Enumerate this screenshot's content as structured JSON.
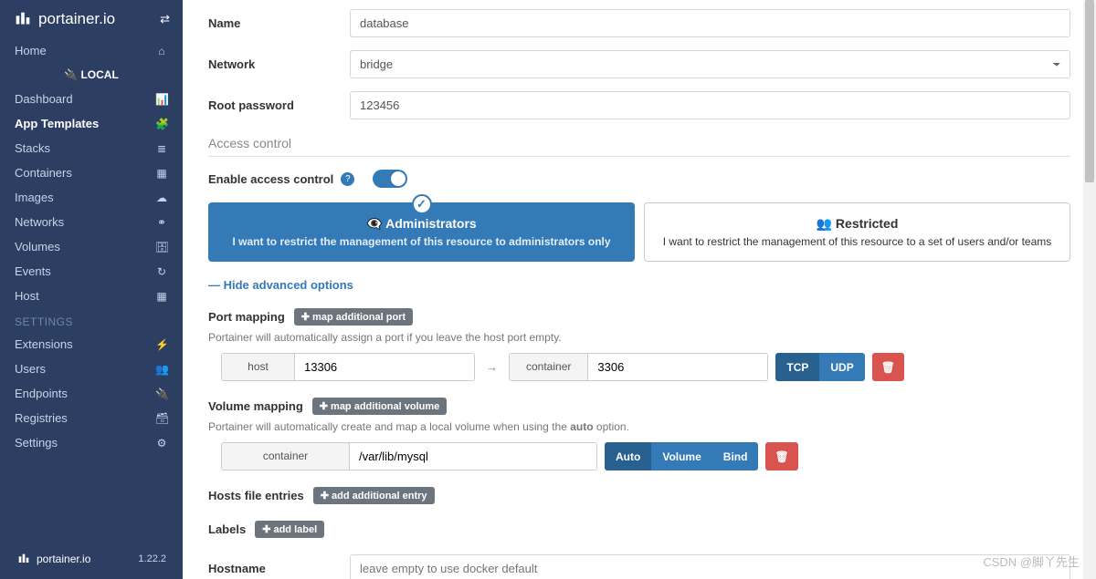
{
  "brand": "portainer.io",
  "version": "1.22.2",
  "sidebar": {
    "home": "Home",
    "local": "LOCAL",
    "items": [
      {
        "label": "Dashboard",
        "icon": "📊"
      },
      {
        "label": "App Templates",
        "icon": "🧩"
      },
      {
        "label": "Stacks",
        "icon": "≣"
      },
      {
        "label": "Containers",
        "icon": "▦"
      },
      {
        "label": "Images",
        "icon": "☁"
      },
      {
        "label": "Networks",
        "icon": "⚭"
      },
      {
        "label": "Volumes",
        "icon": "🗄"
      },
      {
        "label": "Events",
        "icon": "↻"
      },
      {
        "label": "Host",
        "icon": "▦"
      }
    ],
    "settings_hdr": "SETTINGS",
    "settings": [
      {
        "label": "Extensions",
        "icon": "⚡"
      },
      {
        "label": "Users",
        "icon": "👥"
      },
      {
        "label": "Endpoints",
        "icon": "🔌"
      },
      {
        "label": "Registries",
        "icon": "🗃"
      },
      {
        "label": "Settings",
        "icon": "⚙"
      }
    ]
  },
  "form": {
    "name_lbl": "Name",
    "name_val": "database",
    "network_lbl": "Network",
    "network_val": "bridge",
    "rootpw_lbl": "Root password",
    "rootpw_val": "123456",
    "access_hdr": "Access control",
    "enable_lbl": "Enable access control",
    "card_admin_title": "Administrators",
    "card_admin_desc": "I want to restrict the management of this resource to administrators only",
    "card_rest_title": "Restricted",
    "card_rest_desc": "I want to restrict the management of this resource to a set of users and/or teams",
    "hide_adv": "—  Hide advanced options",
    "port_hdr": "Port mapping",
    "port_btn": "✚ map additional port",
    "port_hint": "Portainer will automatically assign a port if you leave the host port empty.",
    "host_lbl": "host",
    "host_val": "13306",
    "container_lbl": "container",
    "container_val": "3306",
    "tcp": "TCP",
    "udp": "UDP",
    "vol_hdr": "Volume mapping",
    "vol_btn": "✚ map additional volume",
    "vol_hint_a": "Portainer will automatically create and map a local volume when using the ",
    "vol_hint_b": "auto",
    "vol_hint_c": " option.",
    "vol_container_lbl": "container",
    "vol_container_val": "/var/lib/mysql",
    "auto": "Auto",
    "volume": "Volume",
    "bind": "Bind",
    "hosts_hdr": "Hosts file entries",
    "hosts_btn": "✚ add additional entry",
    "labels_hdr": "Labels",
    "labels_btn": "✚ add label",
    "hostname_lbl": "Hostname",
    "hostname_ph": "leave empty to use docker default"
  },
  "watermark": "CSDN @脚丫先生"
}
